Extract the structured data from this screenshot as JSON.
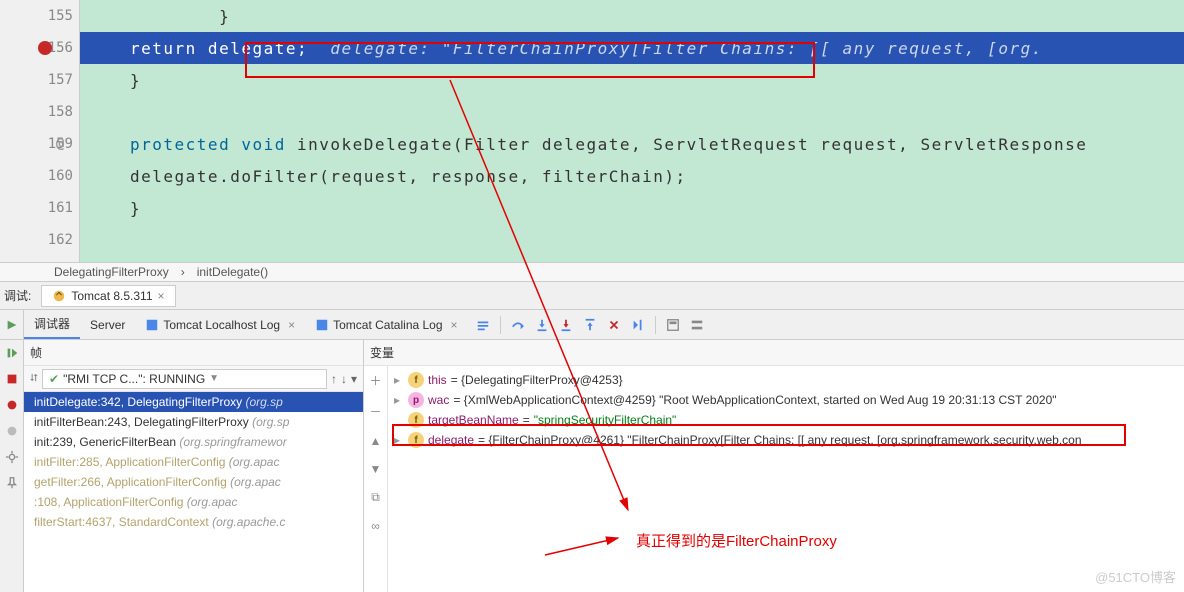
{
  "gutter": [
    "155",
    "156",
    "157",
    "158",
    "159",
    "160",
    "161",
    "162"
  ],
  "code": {
    "return_kw": "return",
    "return_expr": " delegate;  ",
    "inlay": "delegate: \"FilterChainProxy[Filter Chains: [[ any request, [org.",
    "brace_close": "}",
    "protected_kw": "protected ",
    "void_kw": "void ",
    "invoke_sig": "invokeDelegate(Filter delegate, ServletRequest request, ServletResponse",
    "invoke_body": "delegate.doFilter(request, response, filterChain);"
  },
  "breadcrumb": {
    "cls": "DelegatingFilterProxy",
    "sep": "›",
    "method": "initDelegate()"
  },
  "runtab": {
    "label": "调试:",
    "tab": "Tomcat 8.5.311"
  },
  "dbg": {
    "tabs": {
      "debugger": "调试器",
      "server": "Server",
      "log1": "Tomcat Localhost Log",
      "log2": "Tomcat Catalina Log"
    }
  },
  "frames": {
    "title": "帧",
    "thread_status": "\"RMI TCP C...\": RUNNING",
    "items": [
      {
        "m": "initDelegate:342, DelegatingFilterProxy",
        "p": "(org.sp",
        "sel": true
      },
      {
        "m": "initFilterBean:243, DelegatingFilterProxy",
        "p": "(org.sp"
      },
      {
        "m": "init:239, GenericFilterBean",
        "p": "(org.springframewor"
      },
      {
        "m": "initFilter:285, ApplicationFilterConfig",
        "p": "(org.apac",
        "lib": true
      },
      {
        "m": "getFilter:266, ApplicationFilterConfig",
        "p": "(org.apac",
        "lib": true
      },
      {
        "m": "<init>:108, ApplicationFilterConfig",
        "p": "(org.apac",
        "lib": true
      },
      {
        "m": "filterStart:4637, StandardContext",
        "p": "(org.apache.c",
        "lib": true
      }
    ]
  },
  "vars": {
    "title": "变量",
    "rows": {
      "this_n": "this",
      "this_v": " = {DelegatingFilterProxy@4253}",
      "wac_n": "wac",
      "wac_v": " = {XmlWebApplicationContext@4259} \"Root WebApplicationContext, started on Wed Aug 19 20:31:13 CST 2020\"",
      "tbn_n": "targetBeanName",
      "tbn_eq": " = ",
      "tbn_s": "\"springSecurityFilterChain\"",
      "del_n": "delegate",
      "del_v": " = {FilterChainProxy@4261} \"FilterChainProxy[Filter Chains: [[ any request, [org.springframework.security.web.con"
    }
  },
  "annotation": "真正得到的是FilterChainProxy",
  "watermark": "@51CTO博客"
}
